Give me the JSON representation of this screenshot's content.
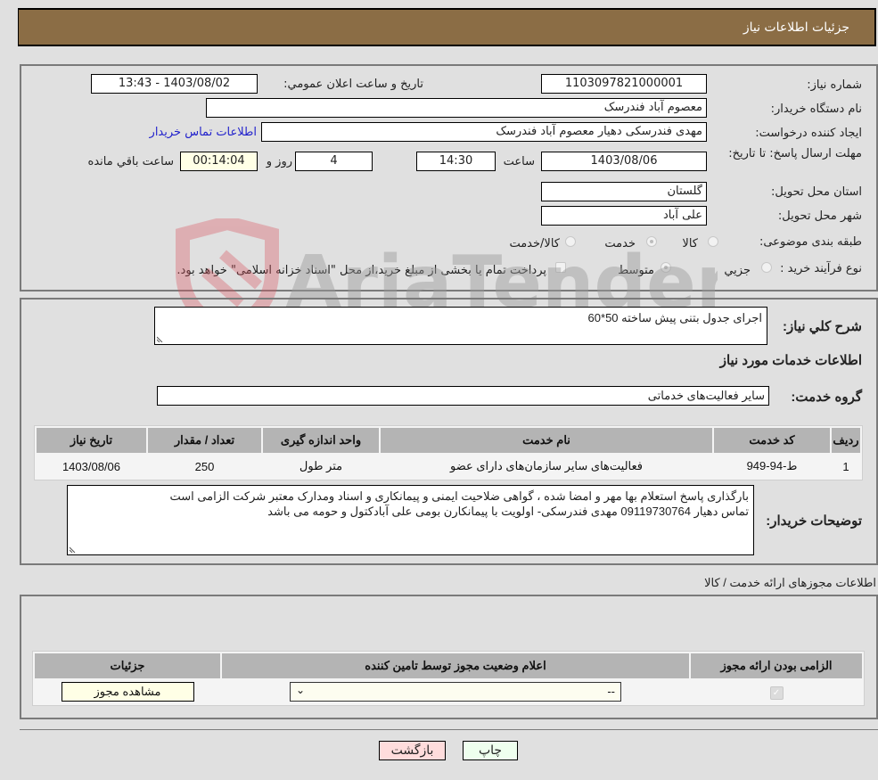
{
  "header": {
    "title": "جزئیات اطلاعات نیاز"
  },
  "details": {
    "need_number_label": "شماره نیاز:",
    "need_number": "1103097821000001",
    "announce_label": "تاریخ و ساعت اعلان عمومي:",
    "announce_value": "1403/08/02 - 13:43",
    "buyer_org_label": "نام دستگاه خریدار:",
    "buyer_org": "معصوم آباد فندرسک",
    "creator_label": "ایجاد کننده درخواست:",
    "creator": "مهدی فندرسکی دهیار معصوم آباد فندرسک",
    "contact_link": "اطلاعات تماس خریدار",
    "deadline_label": "مهلت ارسال پاسخ: تا تاریخ:",
    "deadline_date": "1403/08/06",
    "time_label": "ساعت",
    "deadline_time": "14:30",
    "days": "4",
    "days_label": "روز و",
    "remaining_time": "00:14:04",
    "remaining_label": "ساعت باقي مانده",
    "province_label": "استان محل تحویل:",
    "province": "گلستان",
    "city_label": "شهر محل تحویل:",
    "city": "علی آباد",
    "category_label": "طبقه بندی موضوعی:",
    "category_options": [
      {
        "label": "کالا",
        "selected": false
      },
      {
        "label": "خدمت",
        "selected": true
      },
      {
        "label": "کالا/خدمت",
        "selected": false
      }
    ],
    "process_label": "نوع فرآیند خرید :",
    "process_options": [
      {
        "label": "جزيي",
        "selected": false
      },
      {
        "label": "متوسط",
        "selected": true
      }
    ],
    "treasury_note": "پرداخت تمام یا بخشی از مبلغ خرید،از محل \"اسناد خزانه اسلامی\" خواهد بود.",
    "treasury_checked": false
  },
  "summary": {
    "description_label": "شرح کلي نیاز:",
    "description": "اجرای جدول بتنی پیش ساخته 50*60",
    "services_heading": "اطلاعات خدمات مورد نیاز",
    "service_group_label": "گروه خدمت:",
    "service_group": "سایر فعالیت‌های خدماتی",
    "table": {
      "headers": [
        "ردیف",
        "کد خدمت",
        "نام خدمت",
        "واحد اندازه گیری",
        "تعداد / مقدار",
        "تاریخ نیاز"
      ],
      "rows": [
        [
          "1",
          "ط-94-949",
          "فعالیت‌های سایر سازمان‌های دارای عضو",
          "متر طول",
          "250",
          "1403/08/06"
        ]
      ]
    },
    "buyer_notes_label": "توضیحات خریدار:",
    "buyer_notes_line1": "بارگذاری پاسخ استعلام بها مهر و امضا شده ، گواهی ضلاحیت ایمنی و پیمانکاری و  اسناد ومدارک معتبر شرکت الزامی است",
    "buyer_notes_line2": "تماس دهیار 09119730764 مهدی فندرسکی- اولویت با پیمانکارن بومی علی  آبادکتول  و حومه می باشد"
  },
  "permits": {
    "title": "اطلاعات مجوزهای ارائه خدمت / کالا",
    "headers": [
      "الزامی بودن ارائه مجوز",
      "اعلام وضعیت مجوز توسط تامین کننده",
      "جزئیات"
    ],
    "row": {
      "required_checked": true,
      "status_value": "--",
      "view_button": "مشاهده مجوز"
    }
  },
  "actions": {
    "print": "چاپ",
    "back": "بازگشت"
  },
  "watermark": {
    "text": "AriaTender.neT"
  }
}
